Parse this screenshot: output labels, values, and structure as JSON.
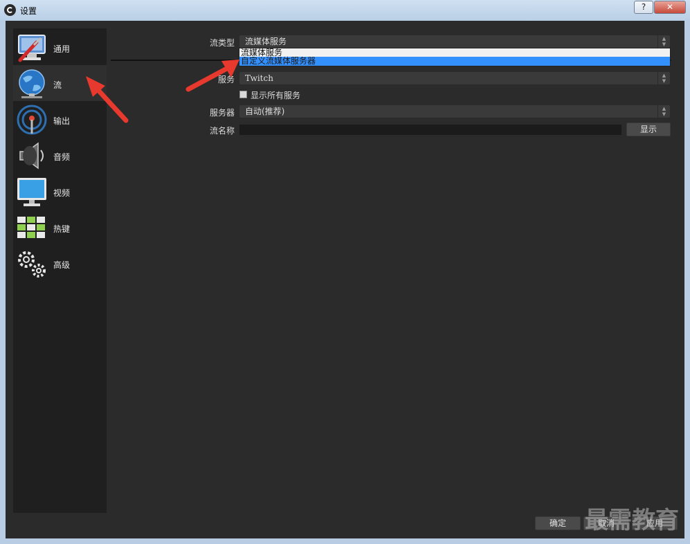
{
  "window": {
    "title": "设置",
    "help_label": "?",
    "close_label": "✕"
  },
  "sidebar": {
    "items": [
      {
        "label": "通用",
        "icon": "general-icon"
      },
      {
        "label": "流",
        "icon": "globe-icon"
      },
      {
        "label": "输出",
        "icon": "output-icon"
      },
      {
        "label": "音频",
        "icon": "audio-icon"
      },
      {
        "label": "视频",
        "icon": "video-icon"
      },
      {
        "label": "热键",
        "icon": "keyboard-icon"
      },
      {
        "label": "高级",
        "icon": "gears-icon"
      }
    ],
    "active": "流"
  },
  "stream": {
    "type_label": "流类型",
    "type_value": "流媒体服务",
    "type_options": [
      "流媒体服务",
      "自定义流媒体服务器"
    ],
    "type_highlighted": "自定义流媒体服务器",
    "service_label": "服务",
    "service_value": "Twitch",
    "show_all_label": "显示所有服务",
    "server_label": "服务器",
    "server_value": "自动(推荐)",
    "key_label": "流名称",
    "key_value": "",
    "show_button": "显示"
  },
  "footer": {
    "ok_label": "确定",
    "cancel_label": "取消",
    "apply_label": "应用"
  },
  "watermark": "最需教育",
  "colors": {
    "panel_bg": "#2b2b2b",
    "sidebar_bg": "#1f1f1f",
    "highlight": "#3390ff",
    "annotation_arrow": "#e8392e"
  }
}
